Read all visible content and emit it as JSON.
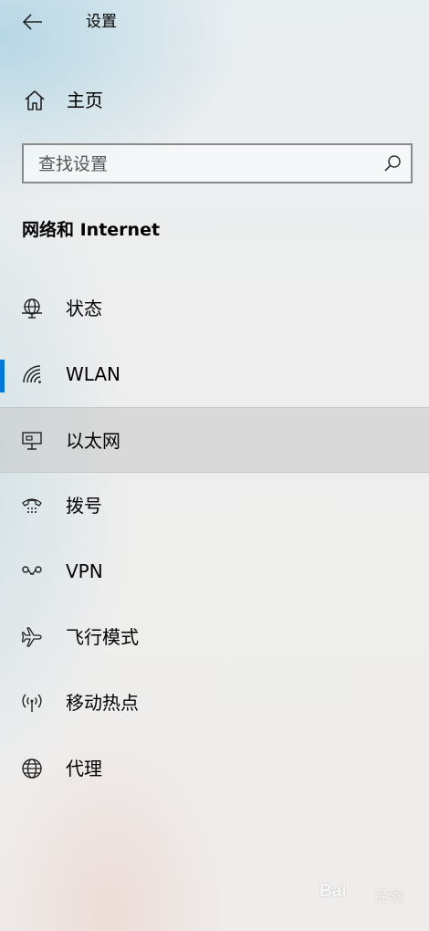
{
  "window": {
    "title": "设置"
  },
  "home": {
    "label": "主页"
  },
  "search": {
    "placeholder": "查找设置",
    "value": ""
  },
  "section": {
    "title": "网络和 Internet"
  },
  "nav": {
    "items": [
      {
        "label": "状态",
        "icon": "globe-status-icon"
      },
      {
        "label": "WLAN",
        "icon": "wifi-icon",
        "selected": true
      },
      {
        "label": "以太网",
        "icon": "ethernet-icon",
        "hovered": true
      },
      {
        "label": "拨号",
        "icon": "dialup-icon"
      },
      {
        "label": "VPN",
        "icon": "vpn-icon"
      },
      {
        "label": "飞行模式",
        "icon": "airplane-icon"
      },
      {
        "label": "移动热点",
        "icon": "hotspot-icon"
      },
      {
        "label": "代理",
        "icon": "globe-icon"
      }
    ]
  },
  "colors": {
    "accent": "#0078d7"
  },
  "watermark": {
    "text": "Bai",
    "sub": "经验"
  }
}
